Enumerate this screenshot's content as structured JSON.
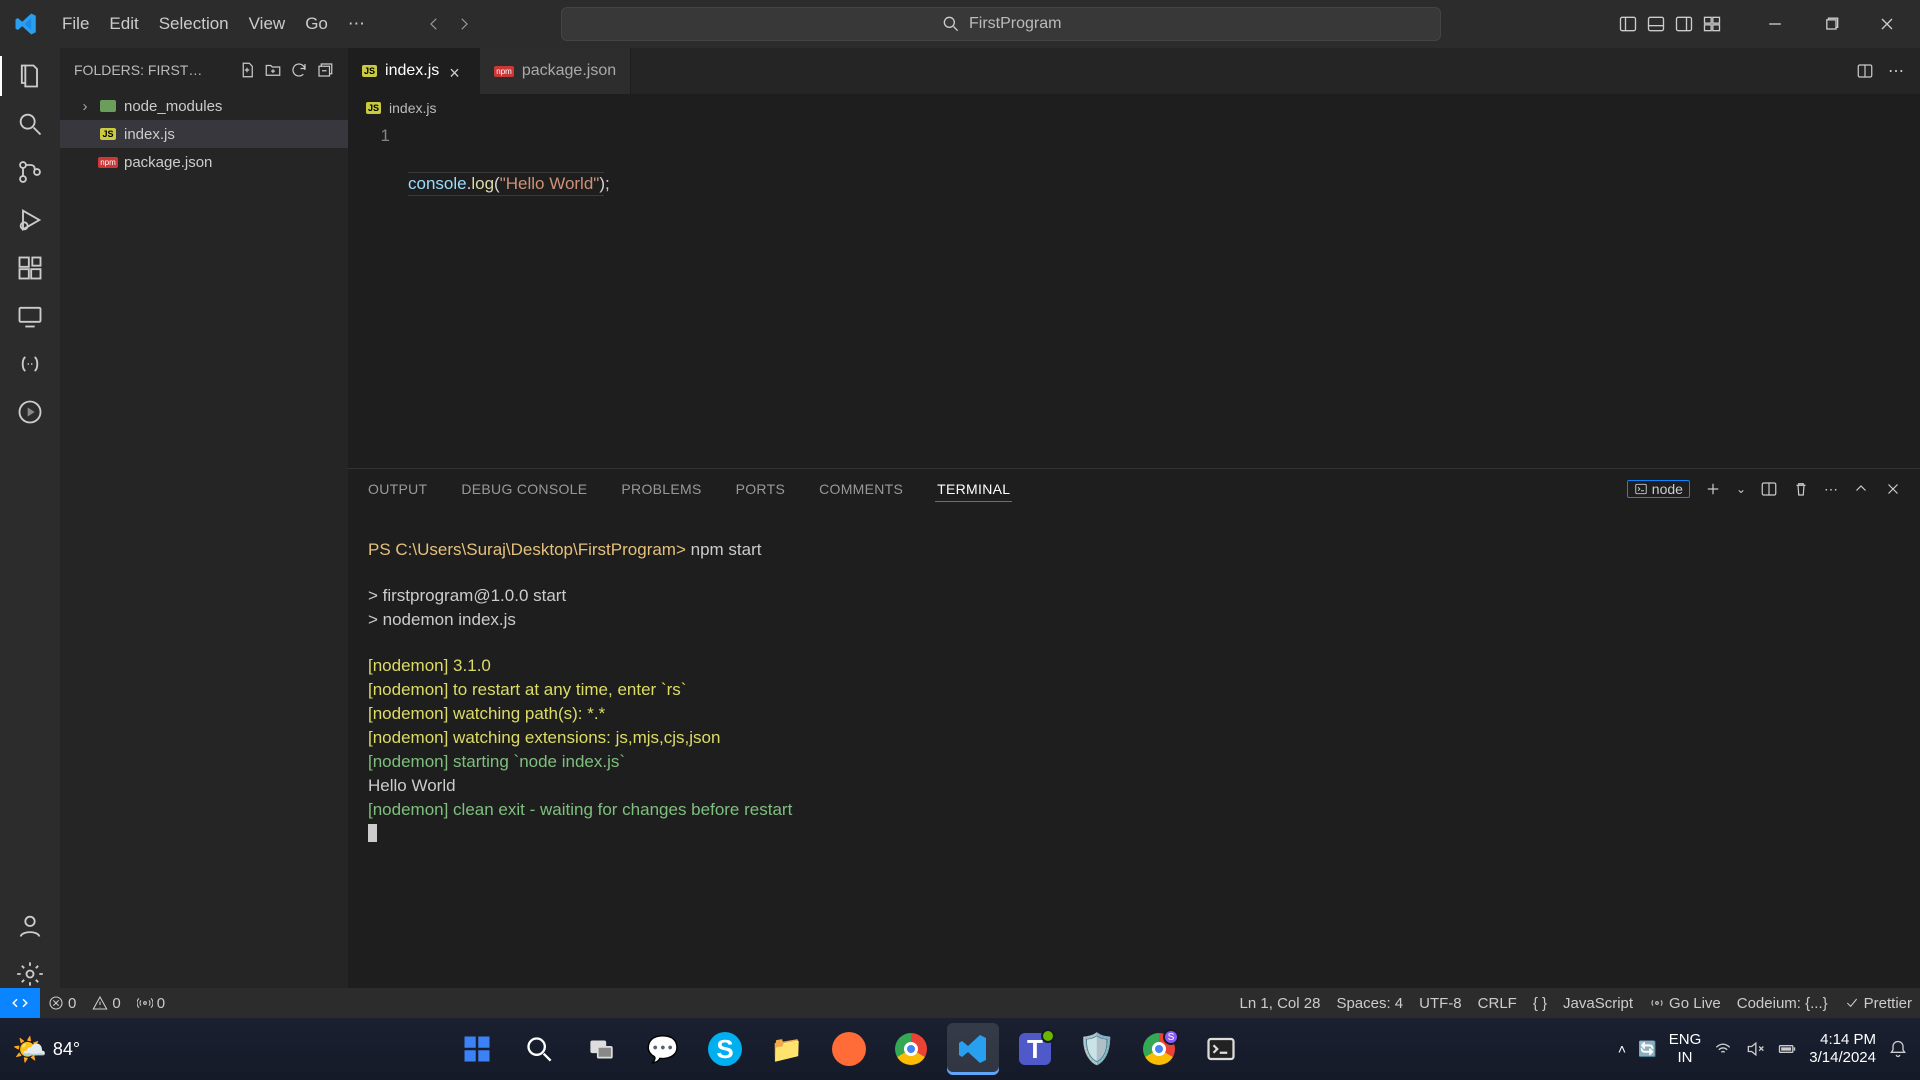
{
  "titlebar": {
    "menus": [
      "File",
      "Edit",
      "Selection",
      "View",
      "Go"
    ],
    "more": "⋯",
    "search_text": "FirstProgram"
  },
  "sidebar": {
    "label": "FOLDERS: FIRST…",
    "items": [
      {
        "name": "node_modules",
        "type": "folder",
        "selected": false,
        "indent": 0,
        "expandable": true
      },
      {
        "name": "index.js",
        "type": "js",
        "selected": true,
        "indent": 1,
        "expandable": false
      },
      {
        "name": "package.json",
        "type": "npm",
        "selected": false,
        "indent": 1,
        "expandable": false
      }
    ]
  },
  "tabs": [
    {
      "label": "index.js",
      "type": "js",
      "active": true,
      "dirty": false
    },
    {
      "label": "package.json",
      "type": "npm",
      "active": false,
      "dirty": false
    }
  ],
  "breadcrumb": {
    "file": "index.js",
    "type": "js"
  },
  "editor": {
    "line_number": "1",
    "tokens": {
      "obj": "console",
      "dot": ".",
      "fn": "log",
      "open": "(",
      "str": "\"Hello World\"",
      "close": ")",
      "semi": ";"
    }
  },
  "panel": {
    "tabs": [
      "OUTPUT",
      "DEBUG CONSOLE",
      "PROBLEMS",
      "PORTS",
      "COMMENTS",
      "TERMINAL"
    ],
    "active_index": 5,
    "terminal_label": "node",
    "terminal": {
      "prompt": "PS C:\\Users\\Suraj\\Desktop\\FirstProgram>",
      "cmd": " npm start",
      "script_lines": [
        "> firstprogram@1.0.0 start",
        "> nodemon index.js"
      ],
      "yellow_lines": [
        "[nodemon] 3.1.0",
        "[nodemon] to restart at any time, enter `rs`",
        "[nodemon] watching path(s): *.*",
        "[nodemon] watching extensions: js,mjs,cjs,json"
      ],
      "start_line": "[nodemon] starting `node index.js`",
      "output_line": "Hello World",
      "exit_line": "[nodemon] clean exit - waiting for changes before restart"
    }
  },
  "statusbar": {
    "errors": "0",
    "warnings": "0",
    "ports": "0",
    "ln_col": "Ln 1, Col 28",
    "spaces": "Spaces: 4",
    "encoding": "UTF-8",
    "eol": "CRLF",
    "lang": "JavaScript",
    "golive": "Go Live",
    "codeium": "Codeium: {...}",
    "prettier": "Prettier",
    "braces": "{ }"
  },
  "taskbar": {
    "weather": "84°",
    "lang1": "ENG",
    "lang2": "IN",
    "time": "4:14 PM",
    "date": "3/14/2024"
  }
}
